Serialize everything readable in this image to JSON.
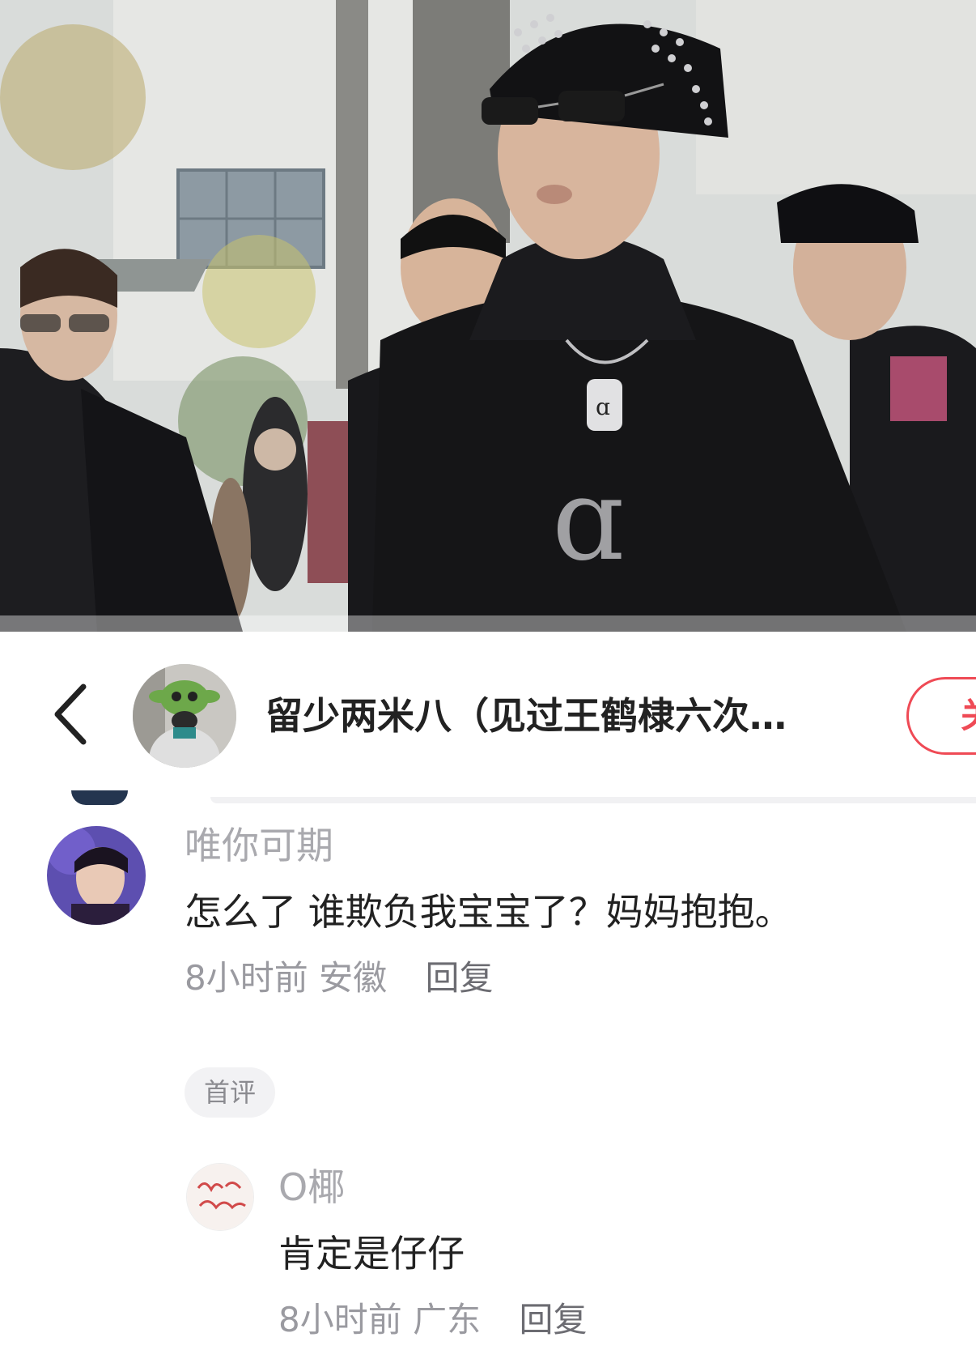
{
  "header": {
    "back_icon": "chevron-left-icon",
    "author_name": "留少两米八（见过王鹤棣六次…",
    "follow_label": "关"
  },
  "comments": [
    {
      "username": "唯你可期",
      "text": "怎么了 谁欺负我宝宝了？妈妈抱抱。",
      "time": "8小时前",
      "location": "安徽",
      "reply_label": "回复",
      "badge": "首评"
    }
  ],
  "replies": [
    {
      "username": "O椰",
      "text": "肯定是仔仔",
      "time": "8小时前",
      "location": "广东",
      "reply_label": "回复"
    }
  ],
  "colors": {
    "accent": "#ef4a55",
    "username": "#a9a9ae",
    "meta": "#9a9aa0",
    "badge_bg": "#f2f2f4"
  }
}
